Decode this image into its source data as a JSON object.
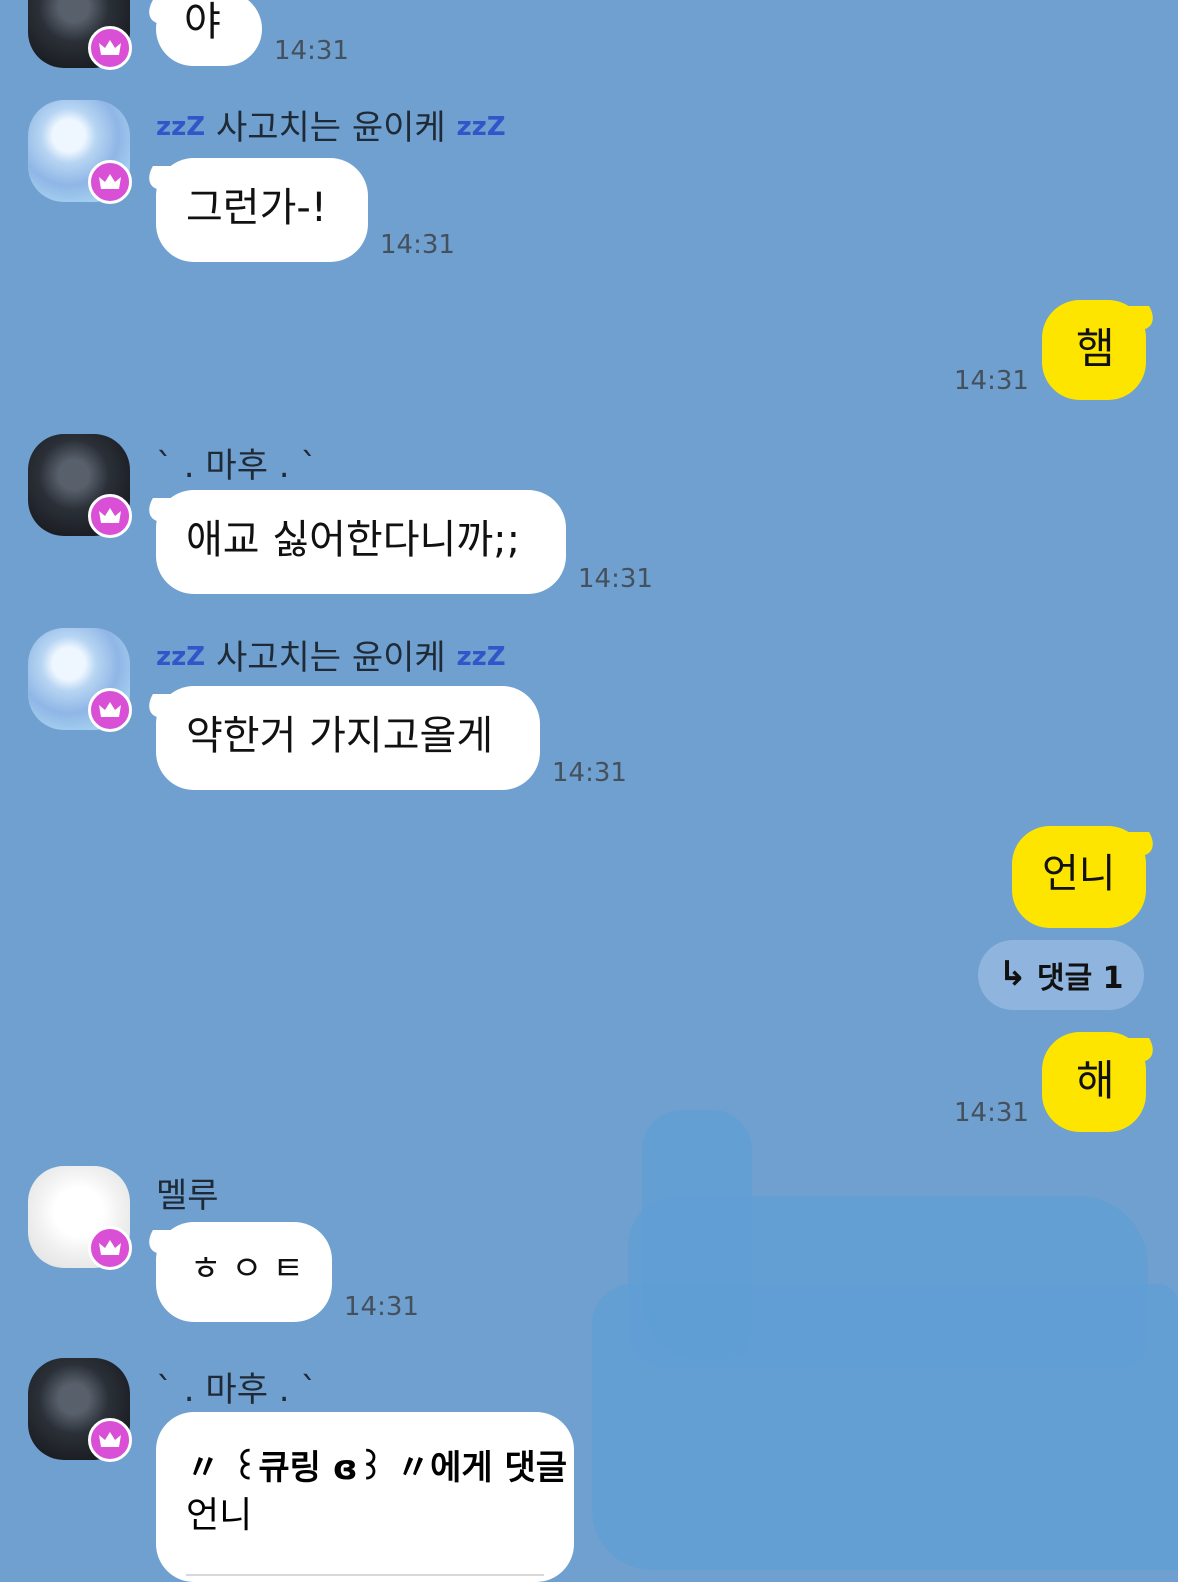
{
  "meta": {
    "theme": {
      "background": "#6fa0cf",
      "incoming_bubble": "#ffffff",
      "outgoing_bubble": "#fee500",
      "crown_badge": "#d94fd6",
      "time_text": "#44515d"
    }
  },
  "messages": [
    {
      "kind": "incoming-continue",
      "text": "야",
      "time": "14:31"
    },
    {
      "kind": "incoming",
      "sender": "ᶻᶻᶻ 사고치는 윤이케 ᶻᶻᶻ",
      "sender_name": "사고치는 윤이케",
      "sender_prefix": "zzZ",
      "sender_suffix": "zzZ",
      "text": "그런가-!",
      "time": "14:31",
      "avatar": "blue-haired-avatar",
      "badge": "crown"
    },
    {
      "kind": "outgoing",
      "text": "햄",
      "time": "14:31"
    },
    {
      "kind": "incoming",
      "sender": "` . 마후 . `",
      "text": "애교 싫어한다니까;;",
      "time": "14:31",
      "avatar": "dark-haired-avatar",
      "badge": "crown"
    },
    {
      "kind": "incoming",
      "sender_name": "사고치는 윤이케",
      "sender_prefix": "zzZ",
      "sender_suffix": "zzZ",
      "text": "약한거 가지고올게",
      "time": "14:31",
      "avatar": "blue-haired-avatar",
      "badge": "crown"
    },
    {
      "kind": "outgoing",
      "text": "언니",
      "time": ""
    },
    {
      "kind": "reply-thread",
      "label": "댓글 1"
    },
    {
      "kind": "outgoing",
      "text": "해",
      "time": "14:31"
    },
    {
      "kind": "incoming",
      "sender": "멜루",
      "text": "ㅎㅇㅌ",
      "time": "14:31",
      "avatar": "white-haired-avatar",
      "badge": "crown"
    },
    {
      "kind": "incoming-reply",
      "sender": "` . 마후 . `",
      "reply_header": "〃 ꒰큐링 ɞ꒱ 〃에게 댓글",
      "reply_quote": "언니",
      "avatar": "dark-haired-avatar",
      "badge": "crown"
    }
  ]
}
